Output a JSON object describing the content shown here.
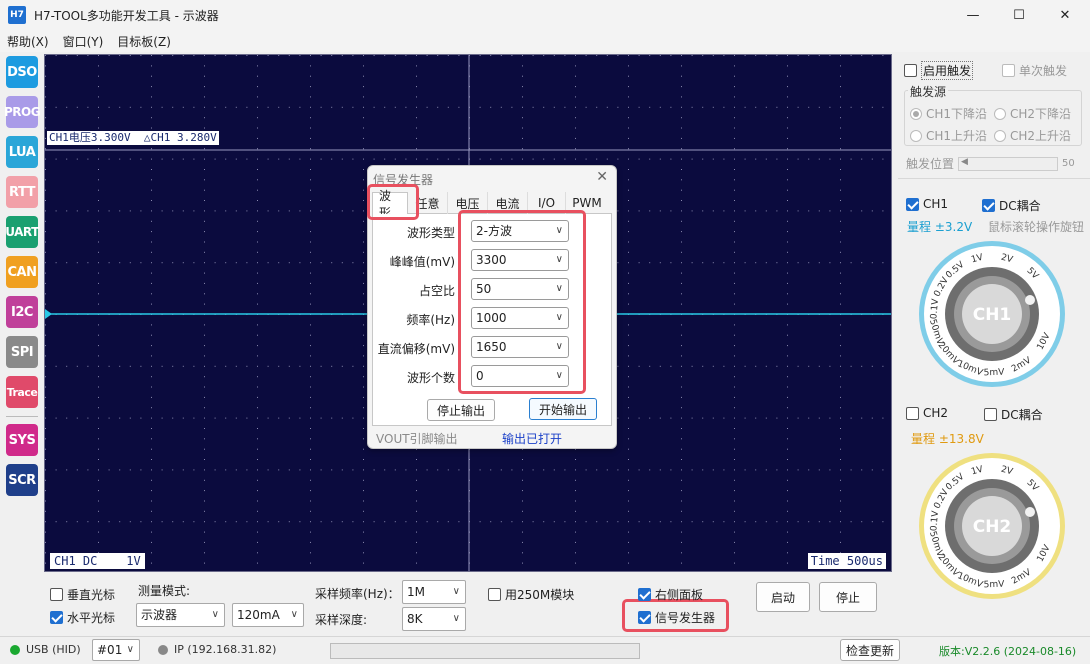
{
  "window": {
    "icon_text": "H7",
    "title": "H7-TOOL多功能开发工具 - 示波器",
    "minimize": "—",
    "maximize": "☐",
    "close": "✕"
  },
  "menu": [
    "帮助(X)",
    "窗口(Y)",
    "目标板(Z)"
  ],
  "left_toolbar": [
    {
      "label": "DSO",
      "color": "#1d9be0"
    },
    {
      "label": "PROG",
      "color": "#a99be8"
    },
    {
      "label": "LUA",
      "color": "#2aa6d8"
    },
    {
      "label": "RTT",
      "color": "#f2a0a8"
    },
    {
      "label": "UART",
      "color": "#1aa070"
    },
    {
      "label": "CAN",
      "color": "#f0a020"
    },
    {
      "label": "I2C",
      "color": "#c0409a"
    },
    {
      "label": "SPI",
      "color": "#8a8a8a"
    },
    {
      "label": "Trace",
      "color": "#e04a6a"
    },
    {
      "label": "SYS",
      "color": "#d02a8a"
    },
    {
      "label": "SCR",
      "color": "#1f3f8a"
    }
  ],
  "scope": {
    "readout_ch1": "CH1电压3.300V",
    "readout_delta": "△CH1 3.280V",
    "ch_label": "CH1 DC    1V",
    "time_label": "Time 500us",
    "bg_color": "#0b0b3e",
    "trace_color": "#29c9e6"
  },
  "signal_gen": {
    "title": "信号发生器",
    "close_icon": "✕",
    "tabs": [
      "波形",
      "任意",
      "电压",
      "电流",
      "I/O",
      "PWM"
    ],
    "active_tab": "波形",
    "fields": [
      {
        "label": "波形类型",
        "value": "2-方波"
      },
      {
        "label": "峰峰值(mV)",
        "value": "3300"
      },
      {
        "label": "占空比",
        "value": "50"
      },
      {
        "label": "频率(Hz)",
        "value": "1000"
      },
      {
        "label": "直流偏移(mV)",
        "value": "1650"
      },
      {
        "label": "波形个数",
        "value": "0"
      }
    ],
    "stop_btn": "停止输出",
    "start_btn": "开始输出",
    "foot_left": "VOUT引脚输出",
    "foot_right": "输出已打开"
  },
  "right_panel": {
    "enable_trigger": "启用触发",
    "single_trigger": "单次触发",
    "trigger_source_title": "触发源",
    "radios": [
      "CH1下降沿",
      "CH2下降沿",
      "CH1上升沿",
      "CH2上升沿"
    ],
    "trigger_pos_label": "触发位置",
    "trigger_pos_value": "50",
    "ch1_label": "CH1",
    "ch1_dc": "DC耦合",
    "ch1_range": "量程 ±3.2V",
    "ch1_range_color": "#1a9fd0",
    "wheel_hint": "鼠标滚轮操作旋钮",
    "ch2_label": "CH2",
    "ch2_dc": "DC耦合",
    "ch2_range": "量程 ±13.8V",
    "ch2_range_color": "#e09a10",
    "knob1_label": "CH1",
    "knob2_label": "CH2",
    "knob1_ring_color": "#7fcde8",
    "knob2_ring_color": "#efe080",
    "knob_ticks": [
      "5V",
      "2V",
      "1V",
      "0.5V",
      "0.2V",
      "0.1V",
      "50mV",
      "20mV",
      "10mV",
      "5mV",
      "2mV",
      "10V"
    ]
  },
  "bottom": {
    "vertical_cursor": "垂直光标",
    "horizontal_cursor": "水平光标",
    "measure_mode_label": "测量模式:",
    "measure_mode_value": "示波器",
    "current_value": "120mA",
    "sample_rate_label": "采样频率(Hz)：",
    "sample_rate_value": "1M",
    "sample_depth_label": "采样深度:",
    "sample_depth_value": "8K",
    "use_250m": "用250M模块",
    "right_panel_cb": "右侧面板",
    "signal_gen_cb": "信号发生器",
    "start_btn": "启动",
    "stop_btn": "停止"
  },
  "status": {
    "usb": "USB (HID)",
    "device": "#01",
    "ip": "IP (192.168.31.82)",
    "check_update": "检查更新",
    "version": "版本:V2.2.6 (2024-08-16)"
  }
}
